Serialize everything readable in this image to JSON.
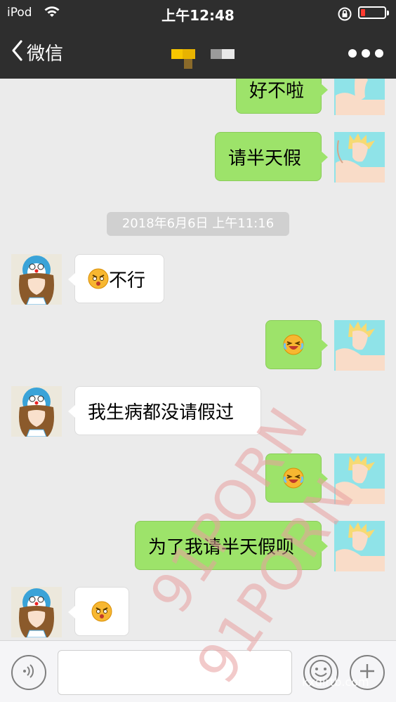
{
  "status": {
    "carrier": "iPod",
    "time": "上午12:48"
  },
  "nav": {
    "back_label": "微信"
  },
  "messages": [
    {
      "side": "out",
      "text": "好不啦"
    },
    {
      "side": "out",
      "text": "请半天假"
    },
    {
      "side": "in",
      "text": "不行",
      "emoji": "annoyed-face"
    },
    {
      "side": "out",
      "text": "",
      "emoji": "laughing-crying-face"
    },
    {
      "side": "in",
      "text": "我生病都没请假过"
    },
    {
      "side": "out",
      "text": "",
      "emoji": "laughing-crying-face"
    },
    {
      "side": "out",
      "text": "为了我请半天假呗"
    },
    {
      "side": "in",
      "text": "",
      "emoji": "annoyed-face"
    }
  ],
  "timestamp": "2018年6月6日 上午11:16",
  "input": {
    "value": ""
  },
  "watermark": {
    "text": "91PORN",
    "small_text": "kxdirtb.com"
  },
  "colors": {
    "bubble_out": "#9de36a",
    "bubble_in": "#ffffff",
    "nav_bg": "#2e2e2e",
    "battery_low": "#ff3b30"
  },
  "icons": {
    "back": "chevron-left-icon",
    "more": "more-dots-icon",
    "voice": "voice-icon",
    "emoji": "emoji-face-icon",
    "add": "plus-icon",
    "wifi": "wifi-icon",
    "lock": "rotation-lock-icon"
  }
}
